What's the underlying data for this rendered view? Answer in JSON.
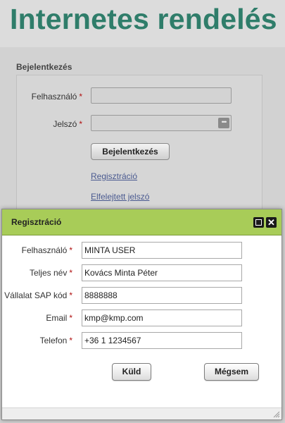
{
  "colors": {
    "title_green": "#2f7d6a",
    "dialog_bar": "#a8cc58",
    "required": "#b01010"
  },
  "site": {
    "title": "Internetes rendelés"
  },
  "login": {
    "section_title": "Bejelentkezés",
    "username_label": "Felhasználó",
    "password_label": "Jelszó",
    "required_marker": "*",
    "password_icon": "key-dots-icon",
    "submit_label": "Bejelentkezés",
    "register_link": "Regisztráció",
    "forgot_link": "Elfelejtett jelszó"
  },
  "dialog": {
    "title": "Regisztráció",
    "maximize_icon": "maximize-icon",
    "close_icon": "close-icon",
    "fields": [
      {
        "label": "Felhasználó",
        "value": "MINTA USER"
      },
      {
        "label": "Teljes név",
        "value": "Kovács Minta Péter"
      },
      {
        "label": "Vállalat SAP kód",
        "value": "8888888"
      },
      {
        "label": "Email",
        "value": "kmp@kmp.com"
      },
      {
        "label": "Telefon",
        "value": "+36 1 1234567"
      }
    ],
    "send_label": "Küld",
    "cancel_label": "Mégsem",
    "resize_icon": "resize-grip-icon"
  }
}
